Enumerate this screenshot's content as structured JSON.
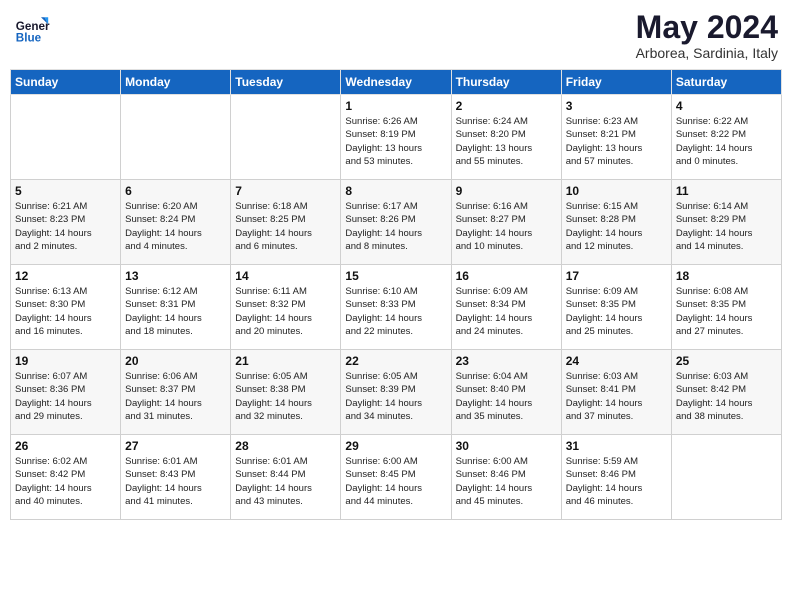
{
  "header": {
    "logo_line1": "General",
    "logo_line2": "Blue",
    "month": "May 2024",
    "location": "Arborea, Sardinia, Italy"
  },
  "weekdays": [
    "Sunday",
    "Monday",
    "Tuesday",
    "Wednesday",
    "Thursday",
    "Friday",
    "Saturday"
  ],
  "weeks": [
    [
      {
        "day": "",
        "info": ""
      },
      {
        "day": "",
        "info": ""
      },
      {
        "day": "",
        "info": ""
      },
      {
        "day": "1",
        "info": "Sunrise: 6:26 AM\nSunset: 8:19 PM\nDaylight: 13 hours\nand 53 minutes."
      },
      {
        "day": "2",
        "info": "Sunrise: 6:24 AM\nSunset: 8:20 PM\nDaylight: 13 hours\nand 55 minutes."
      },
      {
        "day": "3",
        "info": "Sunrise: 6:23 AM\nSunset: 8:21 PM\nDaylight: 13 hours\nand 57 minutes."
      },
      {
        "day": "4",
        "info": "Sunrise: 6:22 AM\nSunset: 8:22 PM\nDaylight: 14 hours\nand 0 minutes."
      }
    ],
    [
      {
        "day": "5",
        "info": "Sunrise: 6:21 AM\nSunset: 8:23 PM\nDaylight: 14 hours\nand 2 minutes."
      },
      {
        "day": "6",
        "info": "Sunrise: 6:20 AM\nSunset: 8:24 PM\nDaylight: 14 hours\nand 4 minutes."
      },
      {
        "day": "7",
        "info": "Sunrise: 6:18 AM\nSunset: 8:25 PM\nDaylight: 14 hours\nand 6 minutes."
      },
      {
        "day": "8",
        "info": "Sunrise: 6:17 AM\nSunset: 8:26 PM\nDaylight: 14 hours\nand 8 minutes."
      },
      {
        "day": "9",
        "info": "Sunrise: 6:16 AM\nSunset: 8:27 PM\nDaylight: 14 hours\nand 10 minutes."
      },
      {
        "day": "10",
        "info": "Sunrise: 6:15 AM\nSunset: 8:28 PM\nDaylight: 14 hours\nand 12 minutes."
      },
      {
        "day": "11",
        "info": "Sunrise: 6:14 AM\nSunset: 8:29 PM\nDaylight: 14 hours\nand 14 minutes."
      }
    ],
    [
      {
        "day": "12",
        "info": "Sunrise: 6:13 AM\nSunset: 8:30 PM\nDaylight: 14 hours\nand 16 minutes."
      },
      {
        "day": "13",
        "info": "Sunrise: 6:12 AM\nSunset: 8:31 PM\nDaylight: 14 hours\nand 18 minutes."
      },
      {
        "day": "14",
        "info": "Sunrise: 6:11 AM\nSunset: 8:32 PM\nDaylight: 14 hours\nand 20 minutes."
      },
      {
        "day": "15",
        "info": "Sunrise: 6:10 AM\nSunset: 8:33 PM\nDaylight: 14 hours\nand 22 minutes."
      },
      {
        "day": "16",
        "info": "Sunrise: 6:09 AM\nSunset: 8:34 PM\nDaylight: 14 hours\nand 24 minutes."
      },
      {
        "day": "17",
        "info": "Sunrise: 6:09 AM\nSunset: 8:35 PM\nDaylight: 14 hours\nand 25 minutes."
      },
      {
        "day": "18",
        "info": "Sunrise: 6:08 AM\nSunset: 8:35 PM\nDaylight: 14 hours\nand 27 minutes."
      }
    ],
    [
      {
        "day": "19",
        "info": "Sunrise: 6:07 AM\nSunset: 8:36 PM\nDaylight: 14 hours\nand 29 minutes."
      },
      {
        "day": "20",
        "info": "Sunrise: 6:06 AM\nSunset: 8:37 PM\nDaylight: 14 hours\nand 31 minutes."
      },
      {
        "day": "21",
        "info": "Sunrise: 6:05 AM\nSunset: 8:38 PM\nDaylight: 14 hours\nand 32 minutes."
      },
      {
        "day": "22",
        "info": "Sunrise: 6:05 AM\nSunset: 8:39 PM\nDaylight: 14 hours\nand 34 minutes."
      },
      {
        "day": "23",
        "info": "Sunrise: 6:04 AM\nSunset: 8:40 PM\nDaylight: 14 hours\nand 35 minutes."
      },
      {
        "day": "24",
        "info": "Sunrise: 6:03 AM\nSunset: 8:41 PM\nDaylight: 14 hours\nand 37 minutes."
      },
      {
        "day": "25",
        "info": "Sunrise: 6:03 AM\nSunset: 8:42 PM\nDaylight: 14 hours\nand 38 minutes."
      }
    ],
    [
      {
        "day": "26",
        "info": "Sunrise: 6:02 AM\nSunset: 8:42 PM\nDaylight: 14 hours\nand 40 minutes."
      },
      {
        "day": "27",
        "info": "Sunrise: 6:01 AM\nSunset: 8:43 PM\nDaylight: 14 hours\nand 41 minutes."
      },
      {
        "day": "28",
        "info": "Sunrise: 6:01 AM\nSunset: 8:44 PM\nDaylight: 14 hours\nand 43 minutes."
      },
      {
        "day": "29",
        "info": "Sunrise: 6:00 AM\nSunset: 8:45 PM\nDaylight: 14 hours\nand 44 minutes."
      },
      {
        "day": "30",
        "info": "Sunrise: 6:00 AM\nSunset: 8:46 PM\nDaylight: 14 hours\nand 45 minutes."
      },
      {
        "day": "31",
        "info": "Sunrise: 5:59 AM\nSunset: 8:46 PM\nDaylight: 14 hours\nand 46 minutes."
      },
      {
        "day": "",
        "info": ""
      }
    ]
  ]
}
